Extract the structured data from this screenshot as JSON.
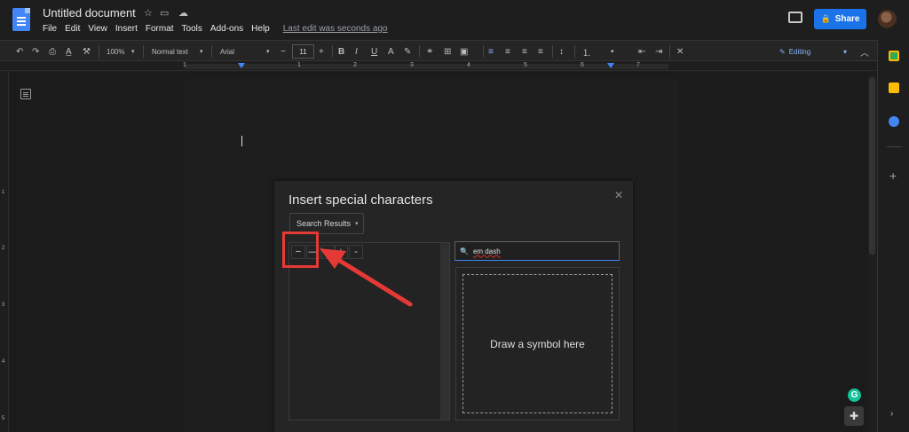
{
  "title": {
    "doc_name": "Untitled document",
    "star_icon": "star-icon",
    "folder_icon": "folder-icon",
    "cloud_icon": "cloud-icon"
  },
  "menu": {
    "items": [
      "File",
      "Edit",
      "View",
      "Insert",
      "Format",
      "Tools",
      "Add-ons",
      "Help"
    ],
    "last_edit": "Last edit was seconds ago"
  },
  "header_right": {
    "share_label": "Share",
    "comment_icon": "comment-icon",
    "avatar": "avatar"
  },
  "toolbar": {
    "zoom": "100%",
    "style": "Normal text",
    "font": "Arial",
    "font_size": "11",
    "editing_mode": "Editing"
  },
  "ruler": {
    "labels": [
      "1",
      "1",
      "2",
      "3",
      "4",
      "5",
      "6",
      "7"
    ]
  },
  "vruler": {
    "labels": [
      "1",
      "2",
      "3",
      "4",
      "5"
    ]
  },
  "dialog": {
    "title": "Insert special characters",
    "category": "Search Results",
    "search_value": "em dash",
    "draw_hint": "Draw a symbol here",
    "results": [
      "−",
      "—",
      "",
      "+",
      "-"
    ]
  },
  "colors": {
    "accent": "#1a73e8",
    "annotation": "#e53935",
    "background": "#1e1e1e"
  }
}
